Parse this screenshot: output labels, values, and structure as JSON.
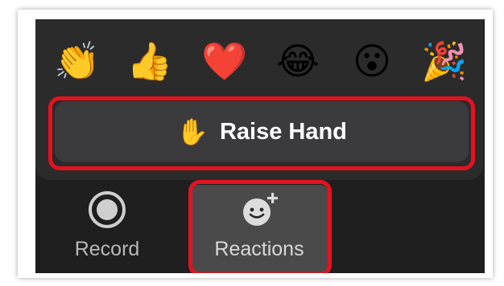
{
  "reactions": [
    {
      "icon": "clapping-hands-icon",
      "glyph": "👏"
    },
    {
      "icon": "thumbs-up-icon",
      "glyph": "👍"
    },
    {
      "icon": "heart-icon",
      "glyph": "❤️"
    },
    {
      "icon": "tears-of-joy-icon",
      "glyph": "😂"
    },
    {
      "icon": "surprised-face-icon",
      "glyph": "😮"
    },
    {
      "icon": "party-popper-icon",
      "glyph": "🎉"
    }
  ],
  "raise_hand": {
    "icon": "raised-hand-icon",
    "glyph": "✋",
    "label": "Raise Hand"
  },
  "toolbar": {
    "record_label": "Record",
    "reactions_label": "Reactions"
  },
  "colors": {
    "highlight": "#e5121f",
    "popup_bg": "#2b2b2b",
    "button_bg": "#3b3b3d",
    "toolbar_bg": "#1f1f1f",
    "active_tool_bg": "#4a4a4a"
  }
}
